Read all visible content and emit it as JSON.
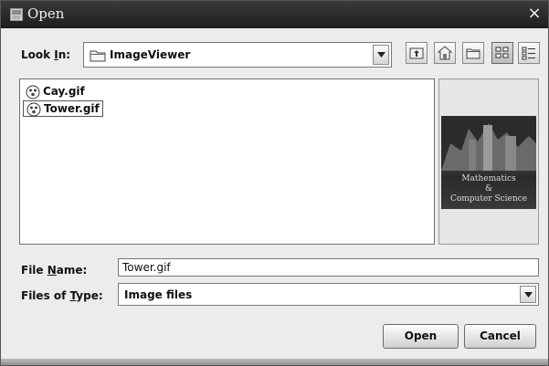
{
  "window": {
    "title": "Open",
    "close_glyph": "×",
    "icon": "app-icon",
    "close_icon": "close-icon"
  },
  "look_in": {
    "label_pre": "Look ",
    "label_mnemonic": "I",
    "label_post": "n:",
    "value": "ImageViewer",
    "icon": "folder-icon"
  },
  "toolbar": [
    {
      "name": "up-one-level-icon"
    },
    {
      "name": "home-icon"
    },
    {
      "name": "new-folder-icon"
    },
    {
      "name": "list-view-icon",
      "active": true
    },
    {
      "name": "details-view-icon"
    }
  ],
  "files": [
    {
      "name": "Cay.gif",
      "icon": "image-file-icon",
      "selected": false
    },
    {
      "name": "Tower.gif",
      "icon": "image-file-icon",
      "selected": true
    }
  ],
  "preview": {
    "line1": "Mathematics",
    "line2": "&",
    "line3": "Computer Science"
  },
  "file_name": {
    "label_pre": "File ",
    "label_mnemonic": "N",
    "label_post": "ame:",
    "value": "Tower.gif"
  },
  "file_type": {
    "label_pre": "Files of ",
    "label_mnemonic": "T",
    "label_post": "ype:",
    "value": "Image files"
  },
  "buttons": {
    "open": "Open",
    "cancel": "Cancel"
  },
  "colors": {
    "titlebar": "#2a2a2a",
    "dialog_bg": "#ececec"
  }
}
